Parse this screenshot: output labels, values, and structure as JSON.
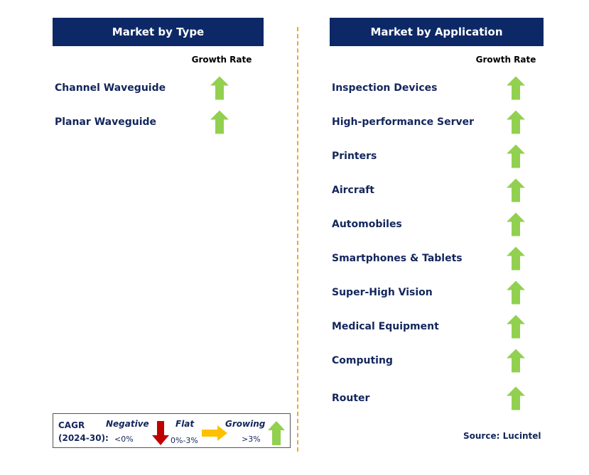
{
  "type_panel": {
    "title": "Market by Type",
    "growth_label": "Growth Rate",
    "items": [
      {
        "label": "Channel Waveguide",
        "trend": "growing"
      },
      {
        "label": "Planar Waveguide",
        "trend": "growing"
      }
    ]
  },
  "application_panel": {
    "title": "Market by Application",
    "growth_label": "Growth Rate",
    "items": [
      {
        "label": "Inspection Devices",
        "trend": "growing"
      },
      {
        "label": "High-performance Server",
        "trend": "growing"
      },
      {
        "label": "Printers",
        "trend": "growing"
      },
      {
        "label": "Aircraft",
        "trend": "growing"
      },
      {
        "label": "Automobiles",
        "trend": "growing"
      },
      {
        "label": "Smartphones & Tablets",
        "trend": "growing"
      },
      {
        "label": "Super-High Vision",
        "trend": "growing"
      },
      {
        "label": "Medical Equipment",
        "trend": "growing"
      },
      {
        "label": "Computing",
        "trend": "growing"
      },
      {
        "label": "Router",
        "trend": "growing"
      }
    ]
  },
  "legend": {
    "cagr": "CAGR",
    "period": "(2024-30):",
    "negative": "Negative",
    "negative_range": "<0%",
    "flat": "Flat",
    "flat_range": "0%-3%",
    "growing": "Growing",
    "growing_range": ">3%"
  },
  "source": "Source: Lucintel",
  "colors": {
    "header": "#0c2866",
    "growing": "#92d050",
    "flat": "#ffc000",
    "negative": "#c00000",
    "divider": "#f0a830"
  }
}
